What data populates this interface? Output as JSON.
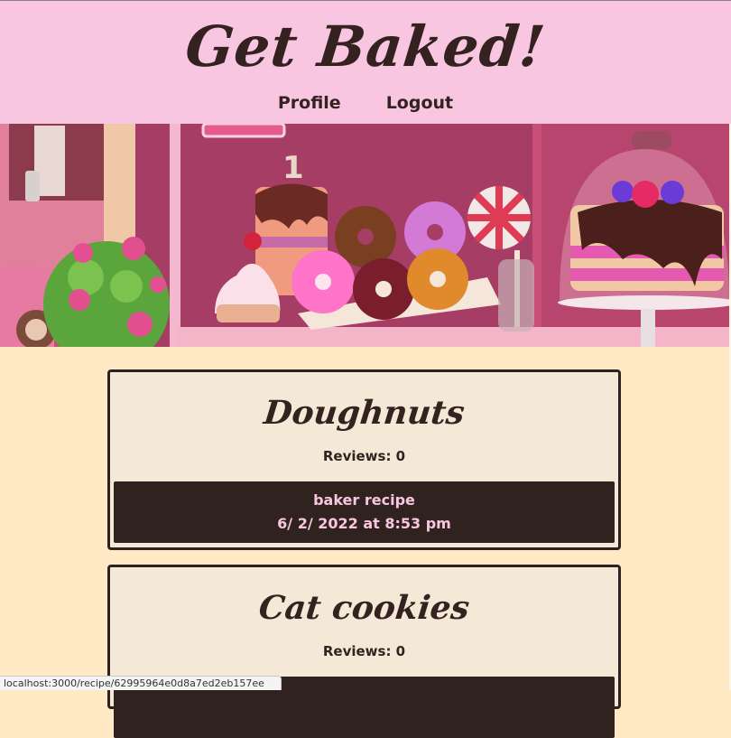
{
  "header": {
    "title": "Get Baked!",
    "nav": [
      {
        "label": "Profile"
      },
      {
        "label": "Logout"
      }
    ]
  },
  "hero": {
    "sign_number": "1"
  },
  "recipes": [
    {
      "title": "Doughnuts",
      "reviews": "Reviews: 0",
      "author": "baker recipe",
      "date": "6/ 2/ 2022 at 8:53 pm"
    },
    {
      "title": "Cat cookies",
      "reviews": "Reviews: 0"
    }
  ],
  "status_bar": {
    "url": "localhost:3000/recipe/62995964e0d8a7ed2eb157ee"
  },
  "colors": {
    "header_bg": "#f9c6e1",
    "page_bg": "#ffeac5",
    "card_bg": "#f3e9d6",
    "dark": "#30221f",
    "pink_text": "#f9c6e1"
  }
}
